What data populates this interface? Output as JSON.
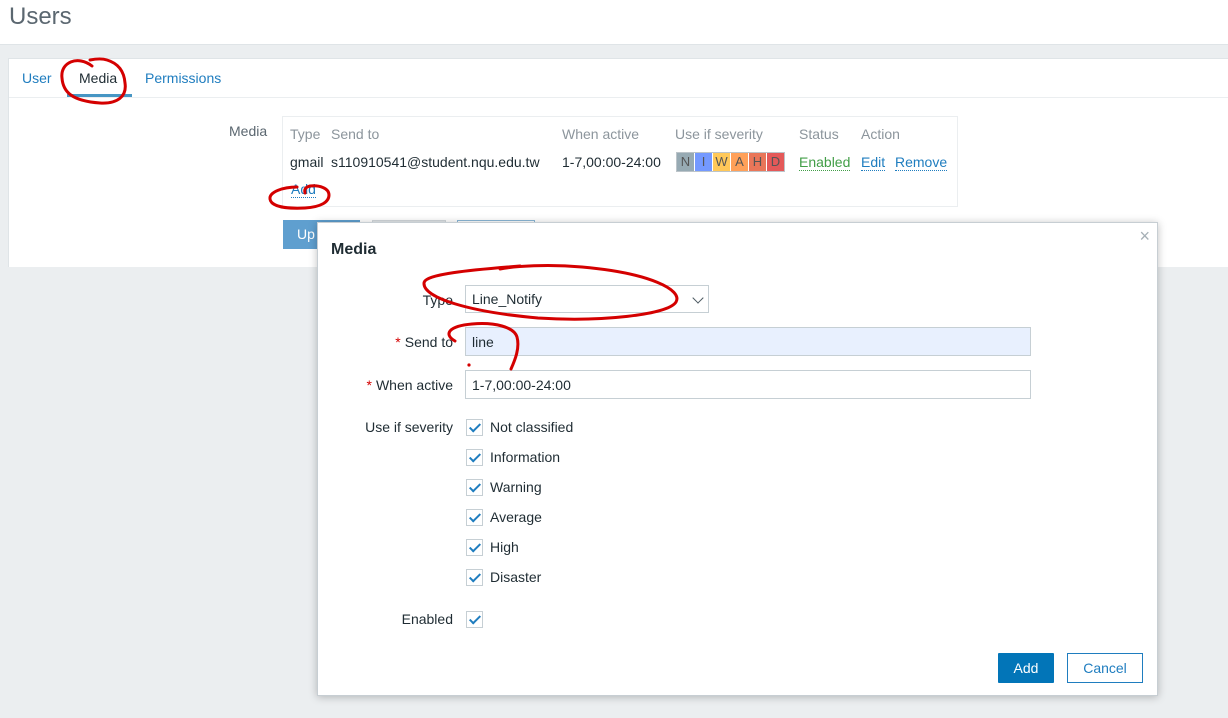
{
  "page": {
    "title": "Users"
  },
  "tabs": [
    {
      "label": "User",
      "active": false
    },
    {
      "label": "Media",
      "active": true
    },
    {
      "label": "Permissions",
      "active": false
    }
  ],
  "media_section": {
    "label": "Media",
    "columns": [
      "Type",
      "Send to",
      "When active",
      "Use if severity",
      "Status",
      "Action"
    ],
    "rows": [
      {
        "type": "gmail",
        "send_to": "s110910541@student.nqu.edu.tw",
        "when_active": "1-7,00:00-24:00",
        "severity_letters": [
          "N",
          "I",
          "W",
          "A",
          "H",
          "D"
        ],
        "status": "Enabled",
        "edit": "Edit",
        "remove": "Remove"
      }
    ],
    "add_link": "Add"
  },
  "form_buttons": {
    "update_label": "Up"
  },
  "dialog": {
    "title": "Media",
    "close_glyph": "×",
    "type_label": "Type",
    "type_value": "Line_Notify",
    "send_to_label": "Send to",
    "send_to_value": "line",
    "when_active_label": "When active",
    "when_active_value": "1-7,00:00-24:00",
    "severity_label": "Use if severity",
    "severities": [
      {
        "label": "Not classified",
        "checked": true
      },
      {
        "label": "Information",
        "checked": true
      },
      {
        "label": "Warning",
        "checked": true
      },
      {
        "label": "Average",
        "checked": true
      },
      {
        "label": "High",
        "checked": true
      },
      {
        "label": "Disaster",
        "checked": true
      }
    ],
    "enabled_label": "Enabled",
    "enabled_checked": true,
    "add_button": "Add",
    "cancel_button": "Cancel"
  },
  "colors": {
    "accent": "#0275b8",
    "link": "#1f7dbf",
    "enabled": "#429e47",
    "annotation": "#d40000",
    "severity": [
      "#97aab3",
      "#7499ff",
      "#ffc859",
      "#ffa059",
      "#e97659",
      "#e45959"
    ]
  }
}
